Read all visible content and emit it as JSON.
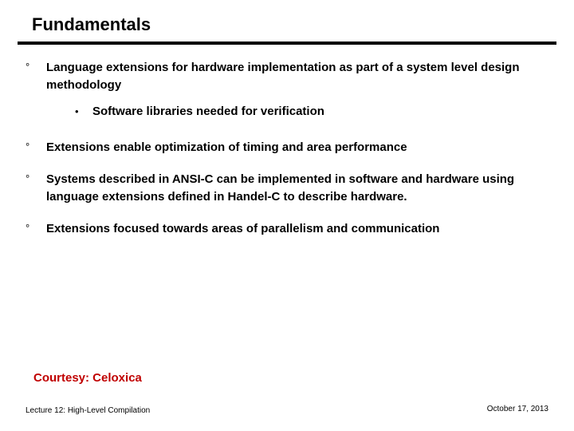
{
  "title": "Fundamentals",
  "bullets": [
    {
      "text": "Language extensions for hardware implementation as part of a system level design methodology",
      "sub": [
        {
          "text": "Software libraries needed for verification"
        }
      ]
    },
    {
      "text": "Extensions enable optimization of timing and area performance"
    },
    {
      "text": "Systems described in ANSI-C can be implemented in software and hardware using language extensions defined in Handel-C to describe hardware."
    },
    {
      "text": "Extensions focused towards areas of parallelism and communication"
    }
  ],
  "courtesy": "Courtesy: Celoxica",
  "footer": {
    "left": "Lecture 12: High-Level Compilation",
    "right": "October 17, 2013"
  }
}
